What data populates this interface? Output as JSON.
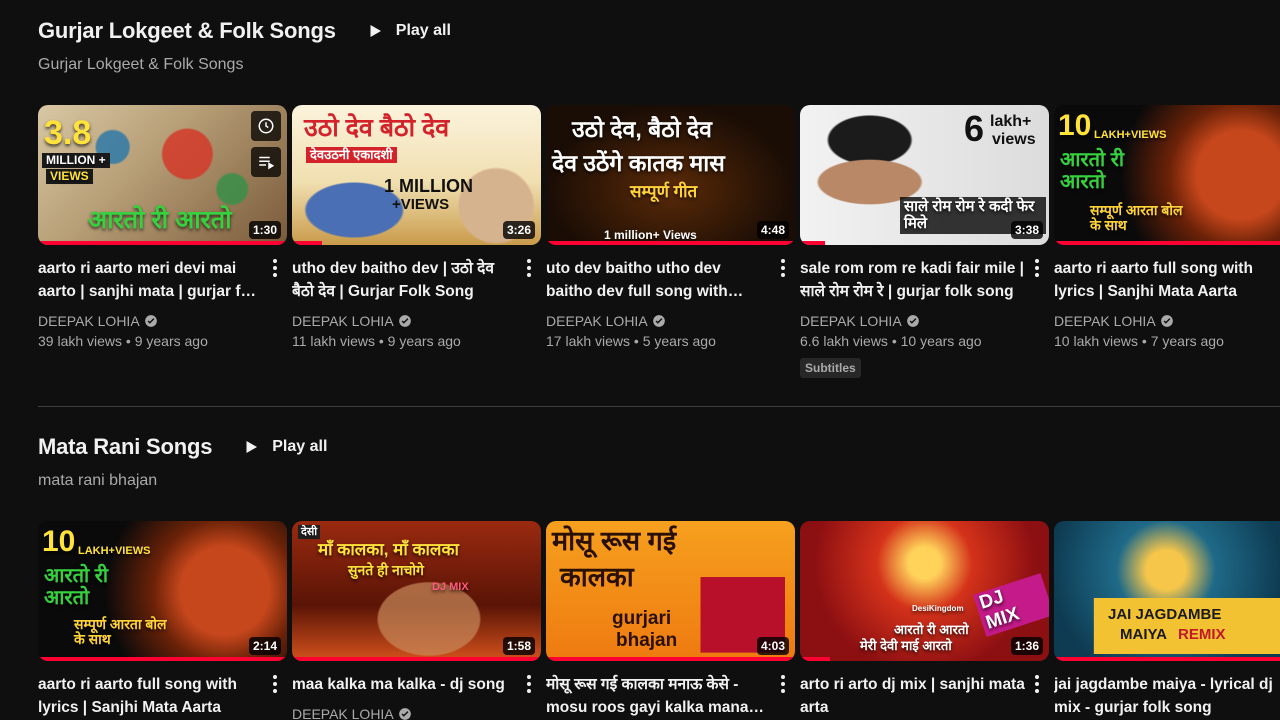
{
  "shelves": [
    {
      "title": "Gurjar Lokgeet & Folk Songs",
      "play_all": "Play all",
      "subtitle": "Gurjar Lokgeet & Folk Songs",
      "videos": [
        {
          "title": "aarto ri aarto meri devi mai aarto | sanjhi mata | gurjar folk song",
          "channel": "DEEPAK LOHIA",
          "stats": "39 lakh views • 9 years ago",
          "duration": "1:30",
          "thumb_text_1": "3.8",
          "thumb_text_2": "MILLION +",
          "thumb_text_3": "VIEWS",
          "thumb_text_4": "आरतो री आरतो",
          "thumb_bg": "#c9b89a"
        },
        {
          "title": "utho dev baitho dev | उठो देव बैठो देव | Gurjar Folk Song",
          "channel": "DEEPAK LOHIA",
          "stats": "11 lakh views • 9 years ago",
          "duration": "3:26",
          "thumb_text_1": "उठो देव बैठो देव",
          "thumb_text_2": "देवउठनी एकादशी",
          "thumb_text_3": "1 MILLION",
          "thumb_text_4": "+VIEWS",
          "thumb_bg": "#f4ead2"
        },
        {
          "title": "uto dev baitho utho dev baitho dev full song with lyrics",
          "channel": "DEEPAK LOHIA",
          "stats": "17 lakh views • 5 years ago",
          "duration": "4:48",
          "thumb_text_1": "उठो देव, बैठो देव",
          "thumb_text_2": "देव उठेंगे कातक मास",
          "thumb_text_3": "सम्पूर्ण गीत",
          "thumb_text_4": "1 million+ Views",
          "thumb_bg": "#1a0d05"
        },
        {
          "title": "sale rom rom re kadi fair mile | साले रोम रोम रे | gurjar folk song",
          "channel": "DEEPAK LOHIA",
          "stats": "6.6 lakh views • 10 years ago",
          "duration": "3:38",
          "badge": "Subtitles",
          "thumb_text_1": "6",
          "thumb_text_2": "lakh+",
          "thumb_text_3": "views",
          "thumb_text_4": "साले रोम रोम रे कदी फेर मिले",
          "thumb_bg": "#e8e8e8"
        },
        {
          "title": "aarto ri aarto full song with lyrics | Sanjhi Mata Aarta",
          "channel": "DEEPAK LOHIA",
          "stats": "10 lakh views • 7 years ago",
          "duration": "",
          "thumb_text_1": "10",
          "thumb_text_2": "LAKH+VIEWS",
          "thumb_text_3": "आरतो री आरतो",
          "thumb_text_4": "सम्पूर्ण आरता बोल के साथ",
          "thumb_bg": "#0a0a0a"
        }
      ]
    },
    {
      "title": "Mata Rani Songs",
      "play_all": "Play all",
      "subtitle": "mata rani bhajan",
      "videos": [
        {
          "title": "aarto ri aarto full song with lyrics | Sanjhi Mata Aarta",
          "channel": "",
          "stats": "",
          "duration": "2:14",
          "thumb_text_1": "10",
          "thumb_text_2": "LAKH+VIEWS",
          "thumb_text_3": "आरतो री आरतो",
          "thumb_text_4": "सम्पूर्ण आरता बोल के साथ",
          "thumb_bg": "#0a0a0a"
        },
        {
          "title": "maa kalka ma kalka - dj song",
          "channel": "DEEPAK LOHIA",
          "stats": "",
          "duration": "1:58",
          "thumb_text_1": "देसी",
          "thumb_text_2": "माँ कालका, माँ कालका",
          "thumb_text_3": "सुनते ही नाचोगे",
          "thumb_text_4": "DJ MIX",
          "thumb_bg": "#7a1e0e"
        },
        {
          "title": "मोसू रूस गई कालका मनाऊ केसे - mosu roos gayi kalka manau kese",
          "channel": "",
          "stats": "",
          "duration": "4:03",
          "thumb_text_1": "मोसू रूस गई",
          "thumb_text_2": "कालका",
          "thumb_text_3": "gurjari",
          "thumb_text_4": "bhajan",
          "thumb_bg": "#f08a14"
        },
        {
          "title": "arto ri arto dj mix | sanjhi mata arta",
          "channel": "",
          "stats": "",
          "duration": "1:36",
          "thumb_text_1": "DJ MIX",
          "thumb_text_2": "आरतो री आरतो",
          "thumb_text_3": "मेरी देवी माई आरतो",
          "thumb_text_4": "DesiKingdom",
          "thumb_bg": "#8c0f12"
        },
        {
          "title": "jai jagdambe maiya - lyrical dj mix - gurjar folk song",
          "channel": "",
          "stats": "",
          "duration": "",
          "thumb_text_1": "JAI JAGDAMBE",
          "thumb_text_2": "MAIYA",
          "thumb_text_3": "REMIX",
          "thumb_text_4": "",
          "thumb_bg": "#0e3b52"
        }
      ]
    }
  ],
  "colors": {
    "background": "#0f0f0f",
    "text": "#f1f1f1",
    "secondary": "#aaaaaa",
    "progress": "#ff0033"
  },
  "icons": {
    "play": "play-icon",
    "more": "more-vert-icon",
    "verified": "verified-icon",
    "watch_later": "clock-icon",
    "queue": "add-to-queue-icon"
  }
}
